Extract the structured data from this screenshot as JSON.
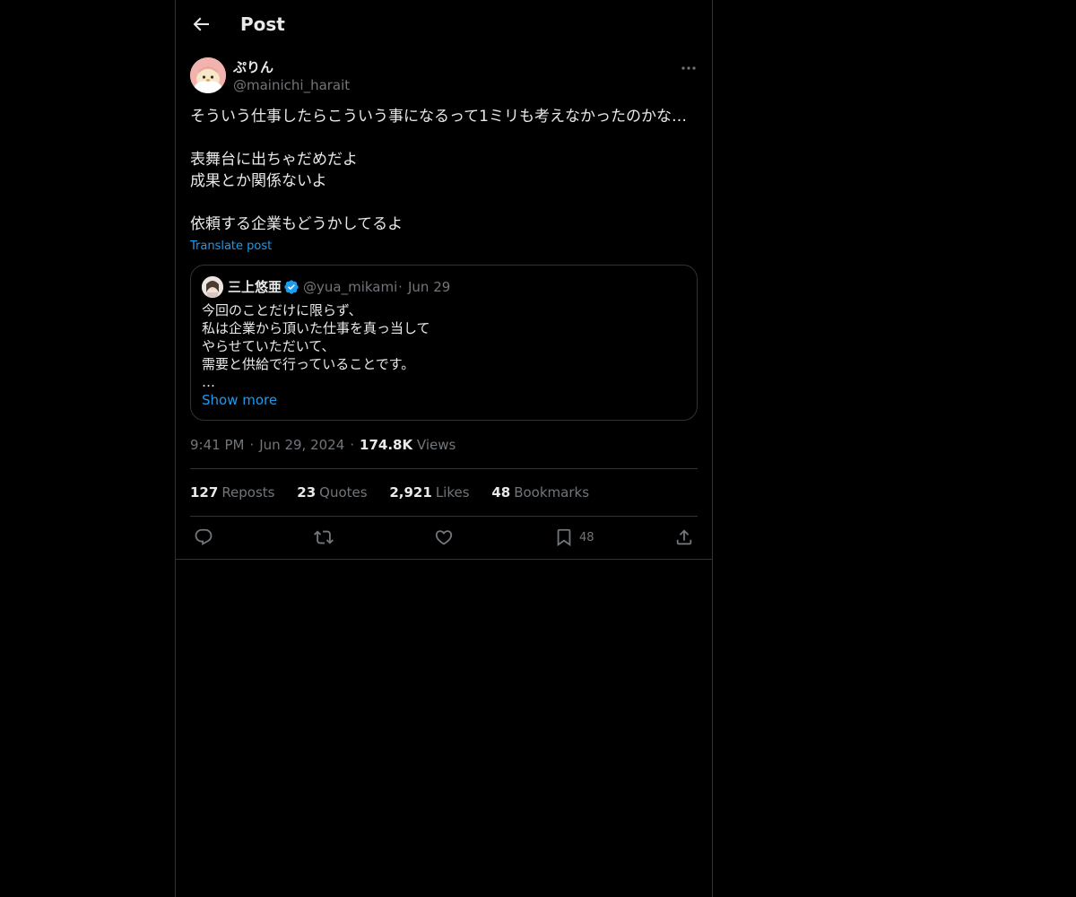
{
  "header": {
    "title": "Post",
    "back_icon": "arrow-left-icon"
  },
  "post": {
    "author": {
      "display_name": "ぷりん",
      "handle": "@mainichi_harait"
    },
    "text": "そういう仕事したらこういう事になるって1ミリも考えなかったのかな…\n\n表舞台に出ちゃだめだよ\n成果とか関係ないよ\n\n依頼する企業もどうかしてるよ",
    "translate_label": "Translate post",
    "quote": {
      "display_name": "三上悠亜",
      "verified": true,
      "handle": "@yua_mikami",
      "separator": "·",
      "date": "Jun 29",
      "text": "今回のことだけに限らず、\n私は企業から頂いた仕事を真っ当して\nやらせていただいて、\n需要と供給で行っていることです。\n…",
      "show_more": "Show more"
    },
    "meta": {
      "time": "9:41 PM",
      "sep1": "·",
      "date": "Jun 29, 2024",
      "sep2": "·",
      "views_count": "174.8K",
      "views_label": "Views"
    },
    "stats": {
      "reposts_count": "127",
      "reposts_label": "Reposts",
      "quotes_count": "23",
      "quotes_label": "Quotes",
      "likes_count": "2,921",
      "likes_label": "Likes",
      "bookmarks_count": "48",
      "bookmarks_label": "Bookmarks"
    },
    "actions": {
      "reply_icon": "reply-icon",
      "repost_icon": "repost-icon",
      "like_icon": "heart-icon",
      "bookmark_icon": "bookmark-icon",
      "bookmark_count": "48",
      "share_icon": "share-icon"
    }
  },
  "colors": {
    "background": "#000000",
    "text": "#e7e9ea",
    "muted": "#71767b",
    "accent": "#1d9bf0",
    "border": "#2f3336"
  }
}
